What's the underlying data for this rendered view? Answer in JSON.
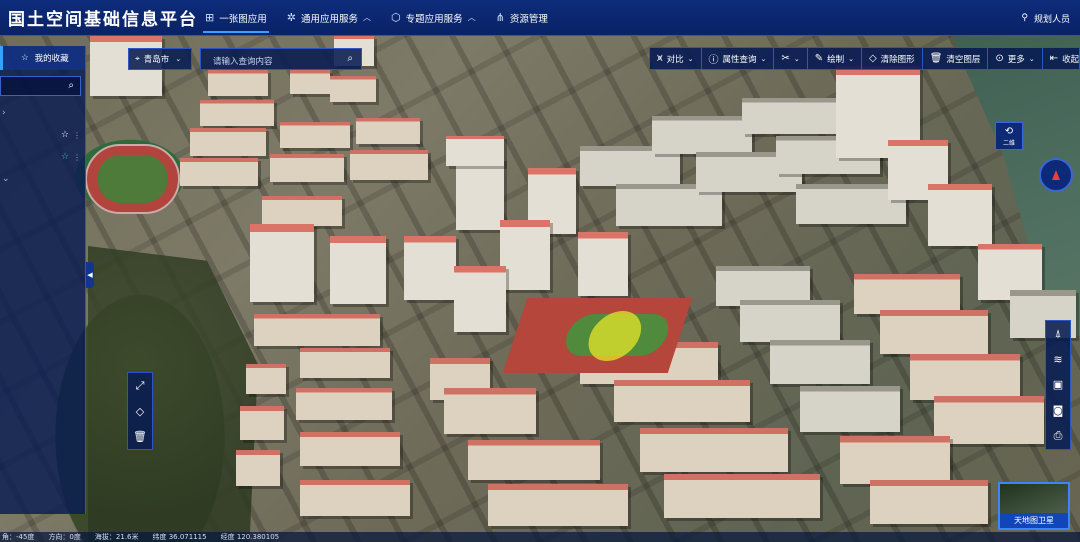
{
  "header": {
    "title": "国土空间基础信息平台",
    "nav": [
      {
        "label": "一张图应用",
        "icon": "grid-icon",
        "active": true,
        "has_dropdown": false
      },
      {
        "label": "通用应用服务",
        "icon": "network-icon",
        "active": false,
        "has_dropdown": true
      },
      {
        "label": "专题应用服务",
        "icon": "cubes-icon",
        "active": false,
        "has_dropdown": true
      },
      {
        "label": "资源管理",
        "icon": "tree-icon",
        "active": false,
        "has_dropdown": false
      }
    ],
    "user": {
      "name": "规划人员",
      "icon": "user-icon"
    }
  },
  "left_panel": {
    "header": "我的收藏",
    "search_placeholder": ""
  },
  "city_select": {
    "value": "青岛市"
  },
  "search": {
    "placeholder": "请输入查询内容"
  },
  "toolbar": {
    "items": [
      {
        "label": "对比",
        "icon": "chart-icon",
        "has_dropdown": true
      },
      {
        "label": "属性查询",
        "icon": "info-icon",
        "has_dropdown": true
      },
      {
        "label": "",
        "icon": "measure-icon",
        "has_dropdown": true
      },
      {
        "label": "绘制",
        "icon": "pen-icon",
        "has_dropdown": true
      },
      {
        "label": "清除图形",
        "icon": "eraser-icon",
        "has_dropdown": false
      },
      {
        "label": "清空图层",
        "icon": "trash-icon",
        "has_dropdown": false
      },
      {
        "label": "更多",
        "icon": "more-icon",
        "has_dropdown": true
      },
      {
        "label": "收起",
        "icon": "collapse-icon",
        "has_dropdown": false
      }
    ]
  },
  "view_mode": {
    "label": "二维"
  },
  "basemap": {
    "label": "天地图卫星"
  },
  "statusbar": {
    "heading": "角：-45度",
    "direction": "方向：0度",
    "altitude": "海拔：21.6米",
    "latitude": "纬度 36.071115",
    "longitude": "经度 120.380105"
  },
  "colors": {
    "header_bg": "#0a2266",
    "panel_bg": "#081c52",
    "accent": "#3aa0ff",
    "border": "#2a56c8",
    "star_active": "#33d19a",
    "compass_needle": "#e8403a"
  }
}
